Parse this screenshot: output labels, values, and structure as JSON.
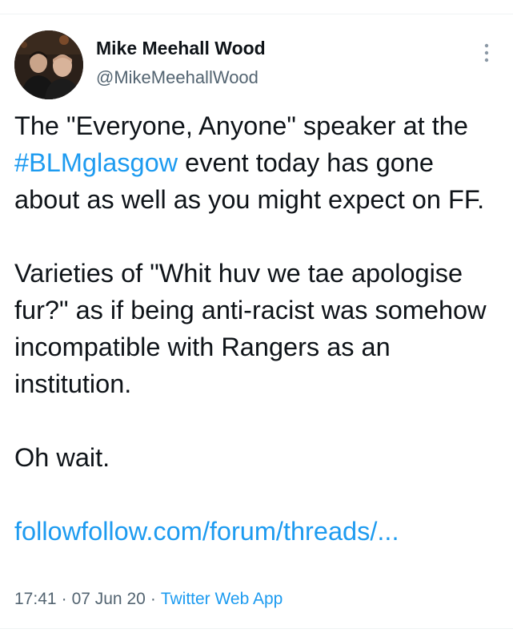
{
  "tweet": {
    "author": {
      "name": "Mike Meehall Wood",
      "handle": "@MikeMeehallWood"
    },
    "body": {
      "p1": {
        "before": "The \"Everyone, Anyone\" speaker at the ",
        "hashtag": "#BLMglasgow",
        "after": " event today has gone about as well as you might expect on FF."
      },
      "p2": "Varieties of \"Whit huv we tae apologise fur?\" as if being anti-racist was somehow incompatible with Rangers as an institution.",
      "p3": "Oh wait.",
      "link": "followfollow.com/forum/threads/..."
    },
    "meta": {
      "time": "17:41",
      "date": "07 Jun 20",
      "separator": "·",
      "source": "Twitter Web App"
    }
  },
  "icons": {
    "more": "vertical-ellipsis-icon",
    "avatar": "profile-photo"
  },
  "colors": {
    "text": "#0f1419",
    "secondary": "#536471",
    "accent": "#1d9bf0"
  }
}
